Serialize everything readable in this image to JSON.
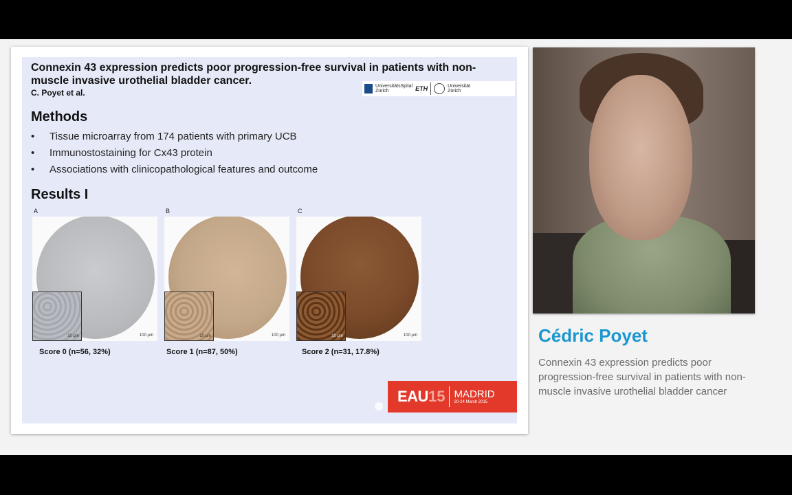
{
  "slide": {
    "title": "Connexin 43 expression predicts poor progression-free survival in patients with non-muscle invasive urothelial bladder cancer.",
    "authors": "C. Poyet et al.",
    "logos": {
      "usz_line1": "UniversitätsSpital",
      "usz_line2": "Zürich",
      "eth": "ETH",
      "uzh_line1": "Universität",
      "uzh_line2": "Zürich"
    },
    "methods_heading": "Methods",
    "methods": [
      "Tissue microarray from 174 patients with primary UCB",
      "Immunostostaining for Cx43 protein",
      "Associations with clinicopathological features and outcome"
    ],
    "results_heading": "Results I",
    "panels": [
      {
        "letter": "A",
        "caption": "Score 0 (n=56, 32%)",
        "inset_scale": "10 µm",
        "scale": "100 µm"
      },
      {
        "letter": "B",
        "caption": "Score 1 (n=87, 50%)",
        "inset_scale": "10 µm",
        "scale": "100 µm"
      },
      {
        "letter": "C",
        "caption": "Score 2 (n=31, 17.8%)",
        "inset_scale": "10 µm",
        "scale": "100 µm"
      }
    ],
    "eau_banner": {
      "main": "EAU",
      "year": "15",
      "city": "MADRID",
      "dates": "20-24 March 2015"
    }
  },
  "speaker": {
    "name": "Cédric Poyet",
    "talk_title": "Connexin 43 expression predicts poor progression-free survival in patients with non-muscle invasive urothelial bladder cancer"
  },
  "colors": {
    "slide_bg": "#e6eaf8",
    "speaker_name": "#1b96cf",
    "eau_red": "#e2392b",
    "score0_stain": "#b9bbbe",
    "score1_stain": "#c4a88a",
    "score2_stain": "#7a4a2a"
  }
}
